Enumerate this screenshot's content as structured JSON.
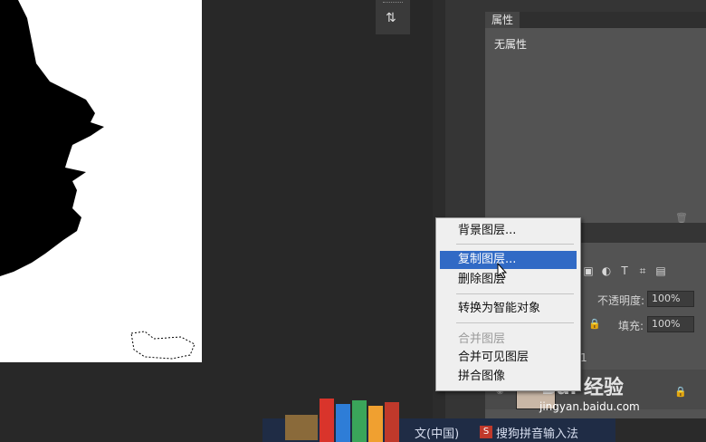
{
  "properties_panel": {
    "tab_label": "属性",
    "empty_text": "无属性",
    "trash_icon": "trash-icon"
  },
  "layers_panel": {
    "opacity_label": "不透明度:",
    "opacity_value": "100%",
    "fill_label": "填充:",
    "fill_value": "100%",
    "layer_name_fragment": "1",
    "toolbar_icons": [
      "image-filter-icon",
      "adjustment-filter-icon",
      "type-filter-icon",
      "shape-filter-icon",
      "smart-object-filter-icon"
    ]
  },
  "context_menu": {
    "items": [
      {
        "label": "背景图层...",
        "enabled": true
      },
      {
        "label": "复制图层...",
        "enabled": true,
        "highlighted": true
      },
      {
        "label": "删除图层",
        "enabled": true
      },
      {
        "label": "转换为智能对象",
        "enabled": true
      },
      {
        "label": "合并图层",
        "enabled": false
      },
      {
        "label": "合并可见图层",
        "enabled": true
      },
      {
        "label": "拼合图像",
        "enabled": true
      }
    ]
  },
  "taskbar": {
    "group_fragment": "文(中国)",
    "ime_label": "搜狗拼音输入法"
  },
  "watermark": {
    "brand": "Bai 经验",
    "url": "jingyan.baidu.com"
  },
  "colors": {
    "menu_highlight": "#316ac5",
    "panel_bg": "#535353",
    "workspace_bg": "#282828"
  }
}
